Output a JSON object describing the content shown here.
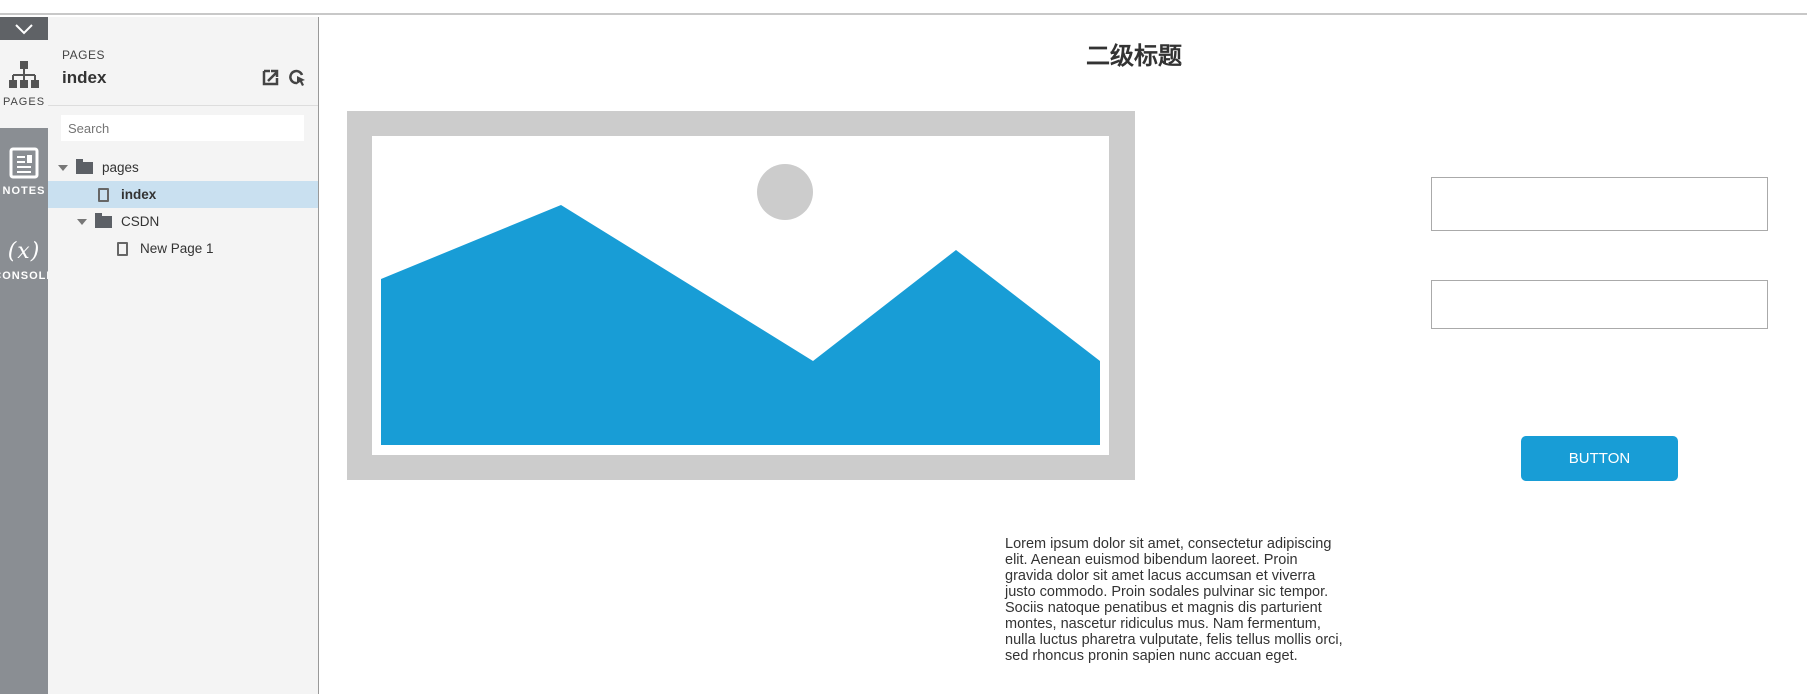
{
  "sidebar": {
    "collapse_icon": "chevron-down-icon",
    "items": [
      {
        "label": "PAGES",
        "icon": "sitemap-icon",
        "active": true
      },
      {
        "label": "NOTES",
        "icon": "notes-icon",
        "active": false
      },
      {
        "label": "CONSOLE",
        "icon": "variable-x-icon",
        "active": false
      }
    ]
  },
  "panel": {
    "section_label": "PAGES",
    "current_page": "index",
    "search_placeholder": "Search",
    "tree": [
      {
        "label": "pages",
        "type": "folder",
        "expanded": true
      },
      {
        "label": "index",
        "type": "page",
        "selected": true
      },
      {
        "label": "CSDN",
        "type": "folder",
        "expanded": true
      },
      {
        "label": "New Page 1",
        "type": "page",
        "selected": false
      }
    ]
  },
  "canvas": {
    "heading": "二级标题",
    "image_placeholder": "image-placeholder-icon",
    "button_label": "BUTTON",
    "input1_value": "",
    "input2_value": "",
    "paragraph": "Lorem ipsum dolor sit amet, consectetur adipiscing elit. Aenean euismod bibendum laoreet. Proin gravida dolor sit amet lacus accumsan et viverra justo commodo. Proin sodales pulvinar sic tempor. Sociis natoque penatibus et magnis dis parturient montes, nascetur ridiculus mus. Nam fermentum, nulla luctus pharetra vulputate, felis tellus mollis orci, sed rhoncus pronin sapien nunc accuan eget."
  },
  "colors": {
    "accent": "#189dd6",
    "selected_row": "#c9e0f0",
    "placeholder_frame": "#cccccc"
  }
}
